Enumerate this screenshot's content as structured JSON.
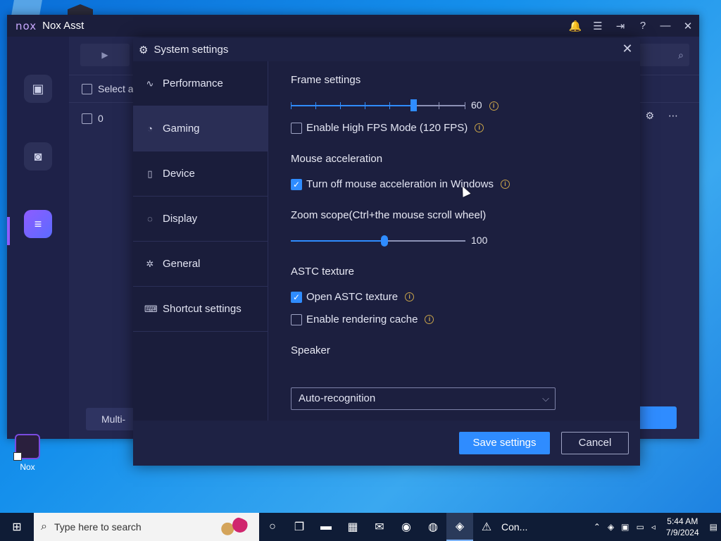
{
  "app": {
    "logo": "nox",
    "title": "Nox Asst"
  },
  "window_controls": [
    "🔔",
    "☰",
    "⇥",
    "?",
    "—",
    "✕"
  ],
  "main": {
    "select_all_label": "Select a",
    "row_index": "0",
    "multi_label": "Multi-"
  },
  "dialog": {
    "title": "System settings",
    "nav": [
      {
        "label": "Performance",
        "icon": "pulse-icon"
      },
      {
        "label": "Gaming",
        "icon": "gamepad-icon",
        "active": true
      },
      {
        "label": "Device",
        "icon": "device-icon"
      },
      {
        "label": "Display",
        "icon": "palette-icon"
      },
      {
        "label": "General",
        "icon": "puzzle-icon"
      },
      {
        "label": "Shortcut settings",
        "icon": "keyboard-icon"
      }
    ],
    "frame": {
      "title": "Frame settings",
      "value": "60",
      "fraction": 0.7,
      "high_fps_label": "Enable High FPS Mode (120 FPS)",
      "high_fps_checked": false
    },
    "mouse": {
      "title": "Mouse acceleration",
      "label": "Turn off mouse acceleration in Windows",
      "checked": true
    },
    "zoom": {
      "title": "Zoom scope(Ctrl+the mouse scroll wheel)",
      "value": "100",
      "fraction": 0.535
    },
    "astc": {
      "title": "ASTC texture",
      "open_label": "Open ASTC texture",
      "open_checked": true,
      "cache_label": "Enable rendering cache",
      "cache_checked": false
    },
    "speaker": {
      "title": "Speaker",
      "selected": "Auto-recognition"
    },
    "buttons": {
      "save": "Save settings",
      "cancel": "Cancel"
    }
  },
  "desktop": {
    "shortcut_label": "Nox"
  },
  "taskbar": {
    "search_placeholder": "Type here to search",
    "running_label": "Con...",
    "time": "5:44 AM",
    "date": "7/9/2024"
  },
  "colors": {
    "accent": "#2f8cff",
    "dialog_bg": "#1c1f3f",
    "window_bg": "#1e2148"
  }
}
